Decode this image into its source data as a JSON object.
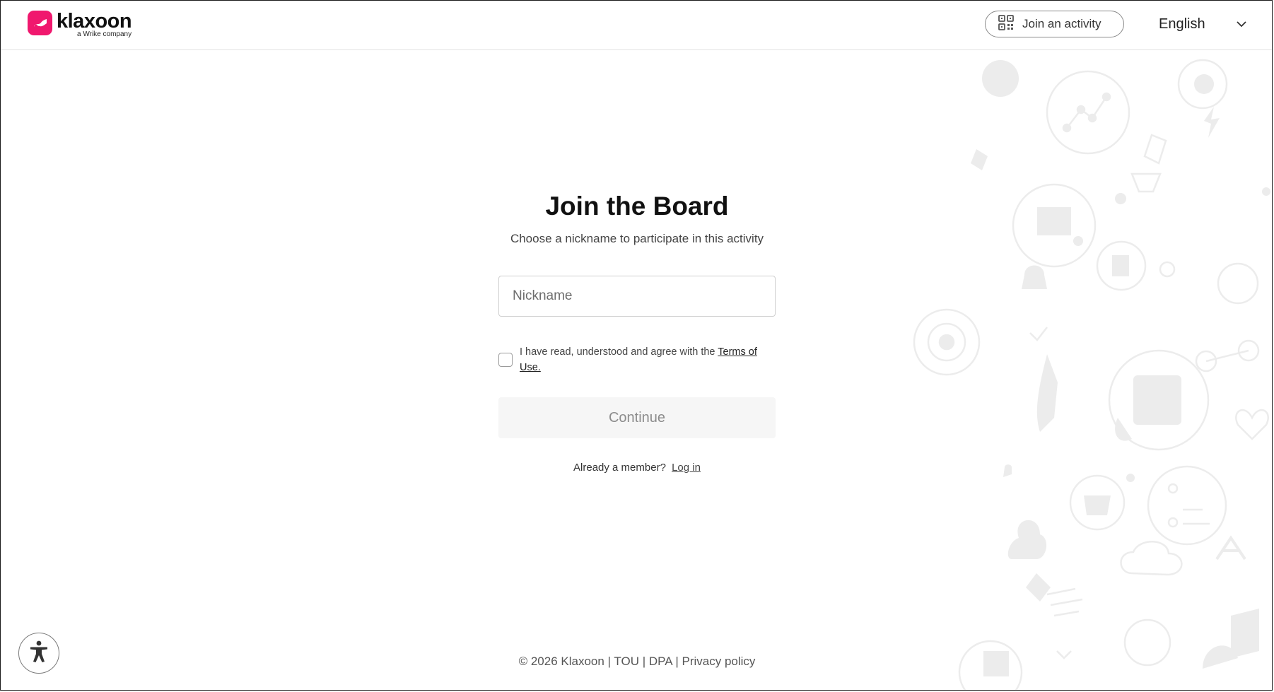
{
  "header": {
    "logo_text": "klaxoon",
    "logo_subtext": "a Wrike company",
    "join_activity_label": "Join an activity",
    "language": "English"
  },
  "main": {
    "title": "Join the Board",
    "subtitle": "Choose a nickname to participate in this activity",
    "nickname_placeholder": "Nickname",
    "nickname_value": "",
    "agree_text": "I have read, understood and agree with the",
    "terms_link": "Terms of Use.",
    "agree_checked": false,
    "continue_label": "Continue",
    "already_member": "Already a member?",
    "login_link": "Log in"
  },
  "footer": {
    "copyright": "© 2026 Klaxoon",
    "sep1": " | ",
    "tou": "TOU",
    "sep2": " | ",
    "dpa": "DPA",
    "sep3": " | ",
    "privacy": "Privacy policy"
  },
  "colors": {
    "brand": "#f0186e",
    "decor": "#ececec"
  },
  "icons": {
    "logo": "klaxoon-logo-icon",
    "join": "qr-code-icon",
    "language": "chevron-down-icon",
    "accessibility": "accessibility-person-icon"
  }
}
